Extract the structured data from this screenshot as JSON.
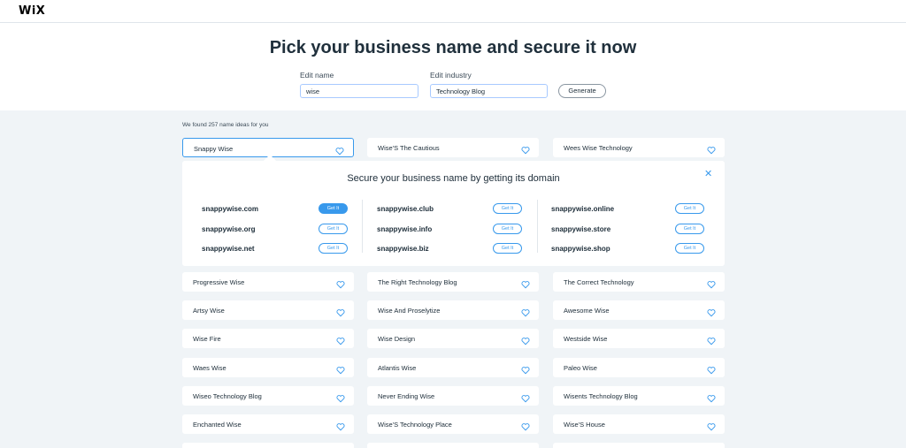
{
  "brand": {
    "logo": "WiX"
  },
  "hero": {
    "title": "Pick your business name and secure it now",
    "name_label": "Edit name",
    "name_value": "wise",
    "industry_label": "Edit industry",
    "industry_value": "Technology Blog",
    "generate_label": "Generate"
  },
  "results": {
    "found_text": "We found 257 name ideas for you",
    "first_row": [
      "Snappy Wise",
      "Wise'S The Cautious",
      "Wees Wise Technology"
    ],
    "selected_index": 0,
    "rows": [
      [
        "Progressive Wise",
        "The Right Technology Blog",
        "The Correct Technology"
      ],
      [
        "Artsy Wise",
        "Wise And Proselytize",
        "Awesome Wise"
      ],
      [
        "Wise Fire",
        "Wise Design",
        "Westside Wise"
      ],
      [
        "Waes Wise",
        "Atlantis Wise",
        "Paleo Wise"
      ],
      [
        "Wiseo Technology Blog",
        "Never Ending Wise",
        "Wisents Technology Blog"
      ],
      [
        "Enchanted Wise",
        "Wise'S Technology Place",
        "Wise'S House"
      ]
    ]
  },
  "domain_panel": {
    "title": "Secure your business name by getting its domain",
    "button_label": "Get It",
    "columns": [
      [
        "snappywise.com",
        "snappywise.org",
        "snappywise.net"
      ],
      [
        "snappywise.club",
        "snappywise.info",
        "snappywise.biz"
      ],
      [
        "snappywise.online",
        "snappywise.store",
        "snappywise.shop"
      ]
    ]
  },
  "colors": {
    "accent": "#3899ec",
    "background": "#f0f4f7",
    "text": "#20303c"
  },
  "icons": {
    "favorite": "heart-outline-icon",
    "close": "close-icon"
  }
}
